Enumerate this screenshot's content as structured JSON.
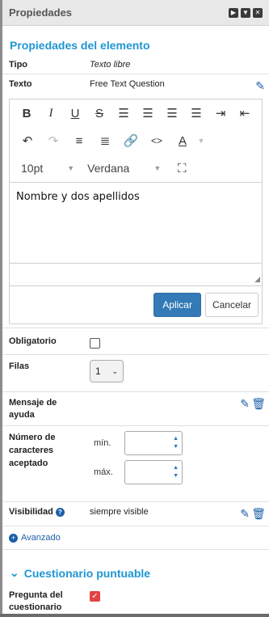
{
  "header": {
    "title": "Propiedades",
    "icons": [
      "play-icon",
      "collapse-icon",
      "close-icon"
    ]
  },
  "section_title": "Propiedades del elemento",
  "tipo": {
    "label": "Tipo",
    "value": "Texto libre"
  },
  "texto": {
    "label": "Texto",
    "value": "Free Text Question"
  },
  "editor": {
    "font_size": "10pt",
    "font_family": "Verdana",
    "content": "Nombre y dos apellidos",
    "apply_label": "Aplicar",
    "cancel_label": "Cancelar"
  },
  "obligatorio": {
    "label": "Obligatorio",
    "checked": false
  },
  "filas": {
    "label": "Filas",
    "value": "1"
  },
  "mensaje": {
    "label": "Mensaje de ayuda"
  },
  "caracteres": {
    "label": "Número de caracteres aceptado",
    "min_label": "mín.",
    "max_label": "máx.",
    "min_value": "",
    "max_value": ""
  },
  "visibilidad": {
    "label": "Visibilidad",
    "value": "siempre visible"
  },
  "avanzado": {
    "label": "Avanzado"
  },
  "cuestionario": {
    "title": "Cuestionario puntuable",
    "pregunta_label": "Pregunta del cuestionario",
    "pregunta_checked": true
  },
  "colors": {
    "accent": "#1f96d3",
    "primary_button": "#337ab7",
    "icon_blue": "#1b5fa8",
    "checked_red": "#e04545"
  }
}
